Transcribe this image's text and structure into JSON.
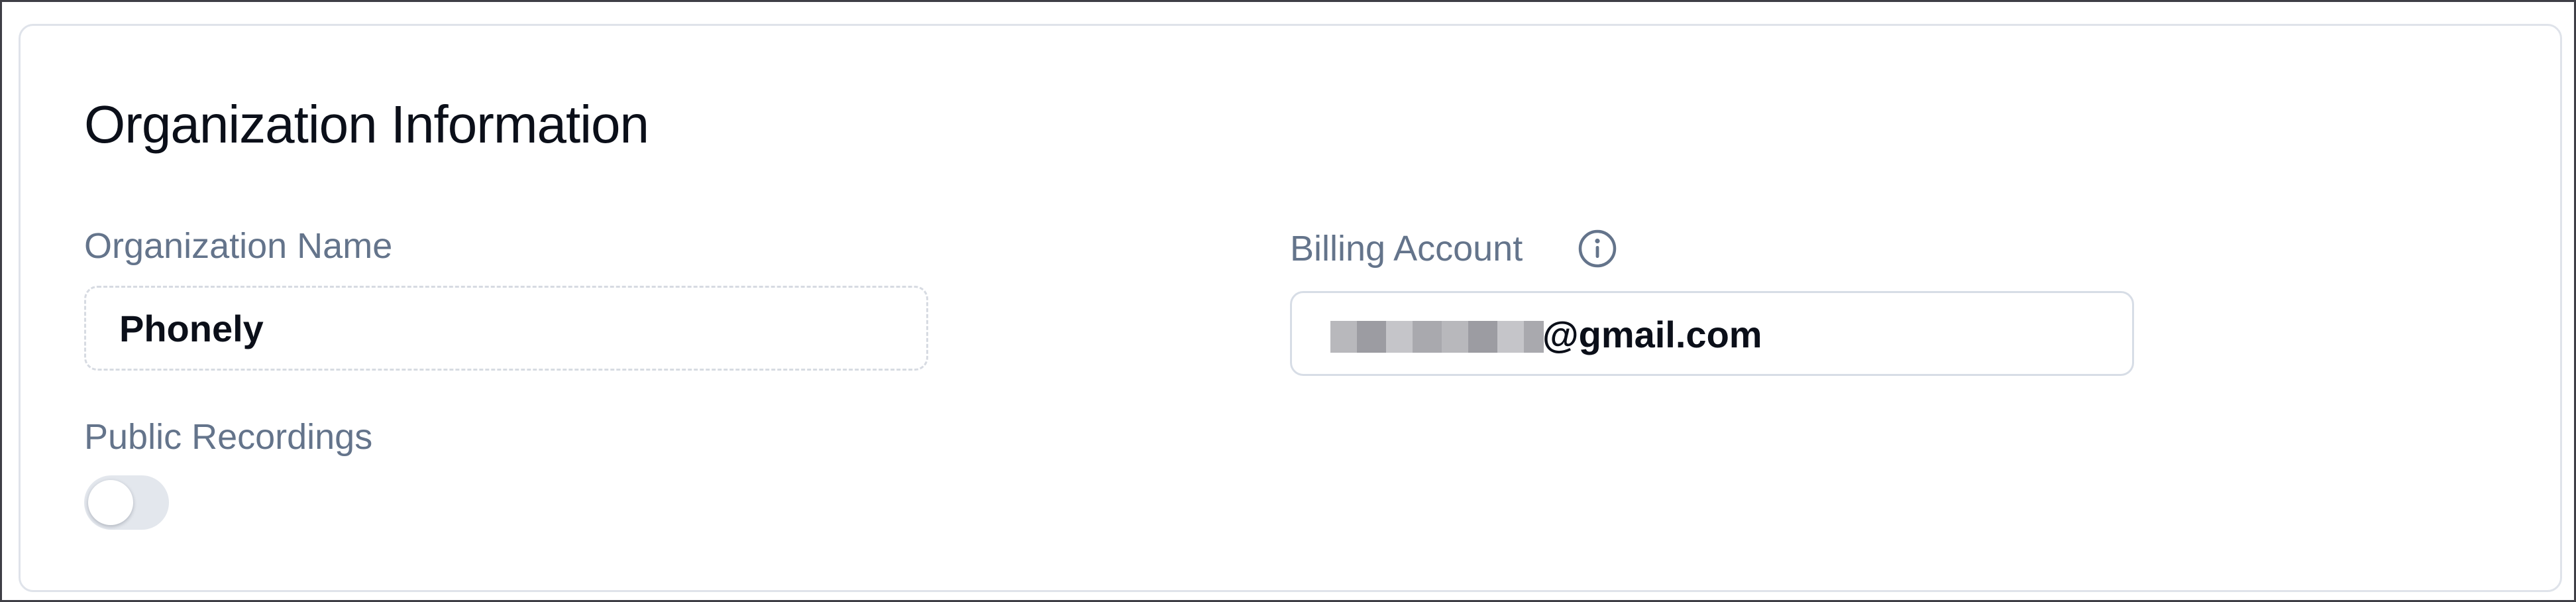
{
  "card": {
    "title": "Organization Information"
  },
  "organization_name": {
    "label": "Organization Name",
    "value": "Phonely"
  },
  "billing_account": {
    "label": "Billing Account",
    "value_visible_suffix": "@gmail.com",
    "info_icon": "info-circle-icon"
  },
  "public_recordings": {
    "label": "Public Recordings",
    "enabled": false
  },
  "colors": {
    "title_text": "#0b0f19",
    "label_text": "#64748b",
    "card_border": "#dfe3ea",
    "input_border": "#d7dde6",
    "toggle_off": "#e3e7ed",
    "toggle_knob": "#ffffff"
  }
}
